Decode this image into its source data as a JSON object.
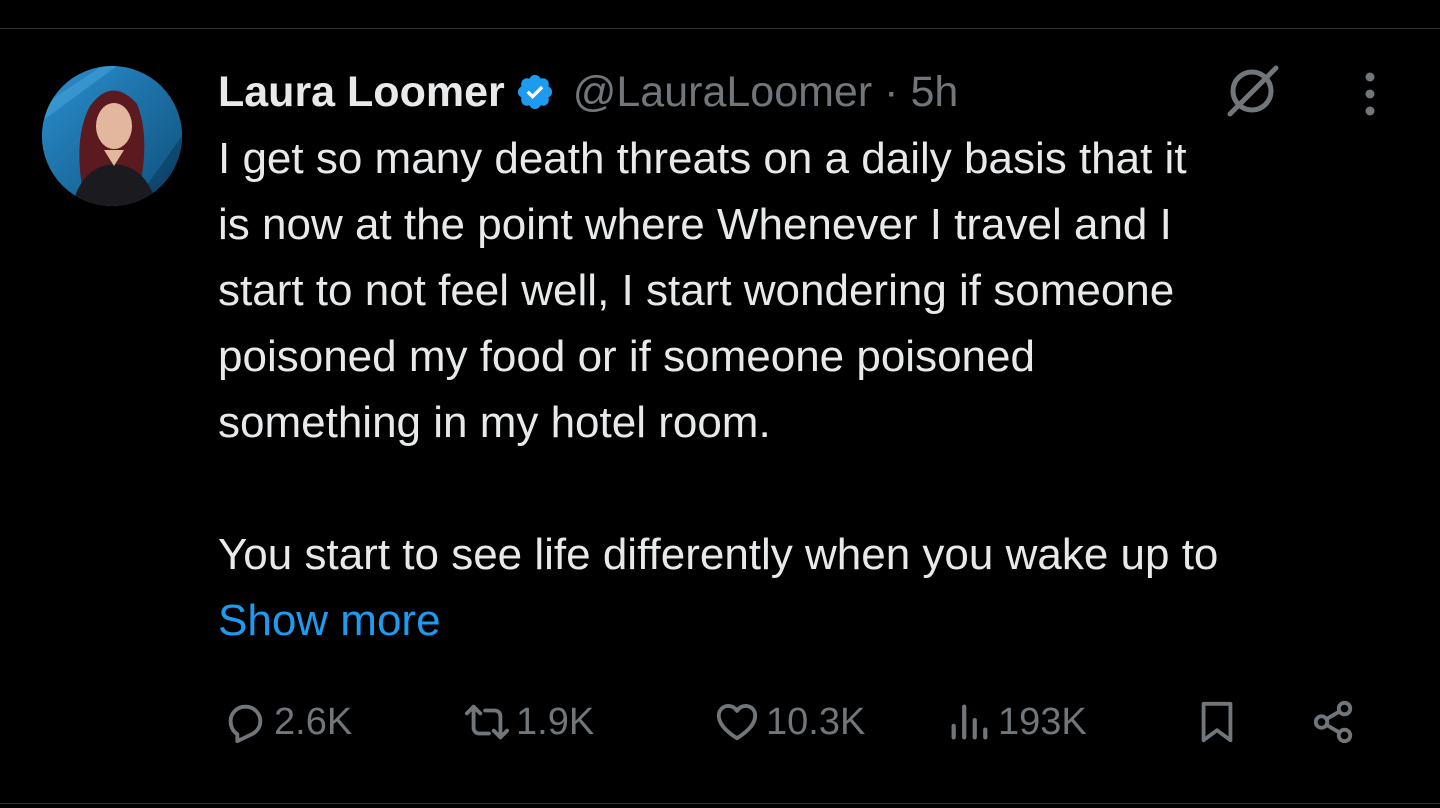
{
  "tweet": {
    "author_name": "Laura Loomer",
    "handle": "@LauraLoomer",
    "separator": "·",
    "time": "5h",
    "text": "I get so many death threats on a daily basis that it\nis now at the point where Whenever I travel and I\nstart to not feel well, I start wondering if someone\npoisoned my food or if someone poisoned\nsomething in my hotel room.\n\nYou start to see life differently when you wake up to",
    "show_more": "Show more"
  },
  "actions": {
    "replies": "2.6K",
    "reposts": "1.9K",
    "likes": "10.3K",
    "views": "193K"
  },
  "icons": {
    "verified": "verified-badge-icon",
    "grok": "grok-icon",
    "more": "more-dots-icon",
    "reply": "reply-icon",
    "repost": "repost-icon",
    "like": "heart-icon",
    "views": "views-icon",
    "bookmark": "bookmark-icon",
    "share": "share-icon"
  },
  "colors": {
    "background": "#000000",
    "text": "#e7e9ea",
    "muted": "#71767b",
    "accent": "#1d9bf0"
  }
}
